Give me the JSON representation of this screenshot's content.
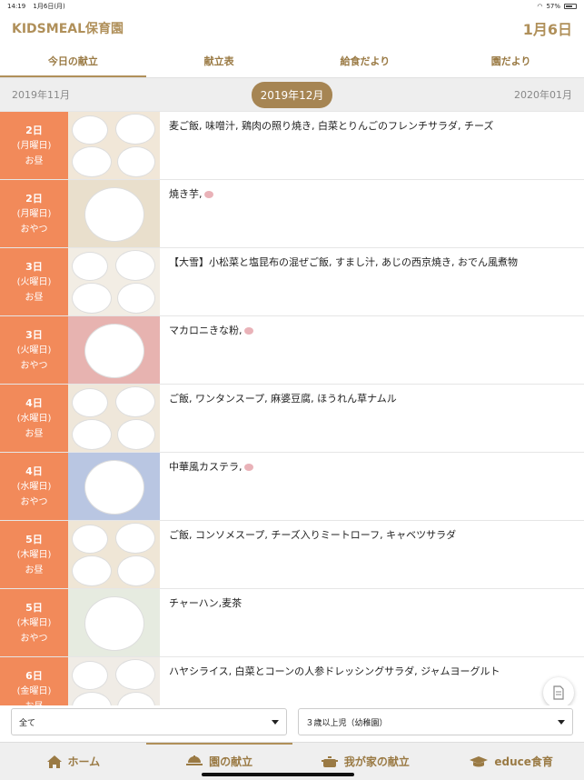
{
  "status": {
    "time": "14:19",
    "date": "1月6日(月)",
    "battery": "57%"
  },
  "header": {
    "brand": "KIDSMEAL保育園",
    "today": "1月6日"
  },
  "tabs": [
    "今日の献立",
    "献立表",
    "給食だより",
    "園だより"
  ],
  "months": {
    "prev": "2019年11月",
    "current": "2019年12月",
    "next": "2020年01月"
  },
  "meals": [
    {
      "day": "2日",
      "weekday": "(月曜日)",
      "type": "お昼",
      "menu": "麦ご飯, 味噌汁, 鶏肉の照り焼き, 白菜とりんごのフレンチサラダ, チーズ",
      "pig": false
    },
    {
      "day": "2日",
      "weekday": "(月曜日)",
      "type": "おやつ",
      "menu": "焼き芋,",
      "pig": true
    },
    {
      "day": "3日",
      "weekday": "(火曜日)",
      "type": "お昼",
      "menu": "【大雪】小松菜と塩昆布の混ぜご飯, すまし汁, あじの西京焼き, おでん風煮物",
      "pig": false
    },
    {
      "day": "3日",
      "weekday": "(火曜日)",
      "type": "おやつ",
      "menu": "マカロニきな粉,",
      "pig": true
    },
    {
      "day": "4日",
      "weekday": "(水曜日)",
      "type": "お昼",
      "menu": "ご飯, ワンタンスープ, 麻婆豆腐, ほうれん草ナムル",
      "pig": false
    },
    {
      "day": "4日",
      "weekday": "(水曜日)",
      "type": "おやつ",
      "menu": "中華風カステラ,",
      "pig": true
    },
    {
      "day": "5日",
      "weekday": "(木曜日)",
      "type": "お昼",
      "menu": "ご飯, コンソメスープ, チーズ入りミートローフ, キャベツサラダ",
      "pig": false
    },
    {
      "day": "5日",
      "weekday": "(木曜日)",
      "type": "おやつ",
      "menu": "チャーハン,麦茶",
      "pig": false
    },
    {
      "day": "6日",
      "weekday": "(金曜日)",
      "type": "お昼",
      "menu": "ハヤシライス, 白菜とコーンの人参ドレッシングサラダ, ジャムヨーグルト",
      "pig": false
    }
  ],
  "filters": {
    "left": "全て",
    "right": "３歳以上児（幼稚園）"
  },
  "nav": [
    "ホーム",
    "園の献立",
    "我が家の献立",
    "educe食育"
  ],
  "colors": {
    "accent": "#b0905a",
    "day": "#f28a5a"
  }
}
